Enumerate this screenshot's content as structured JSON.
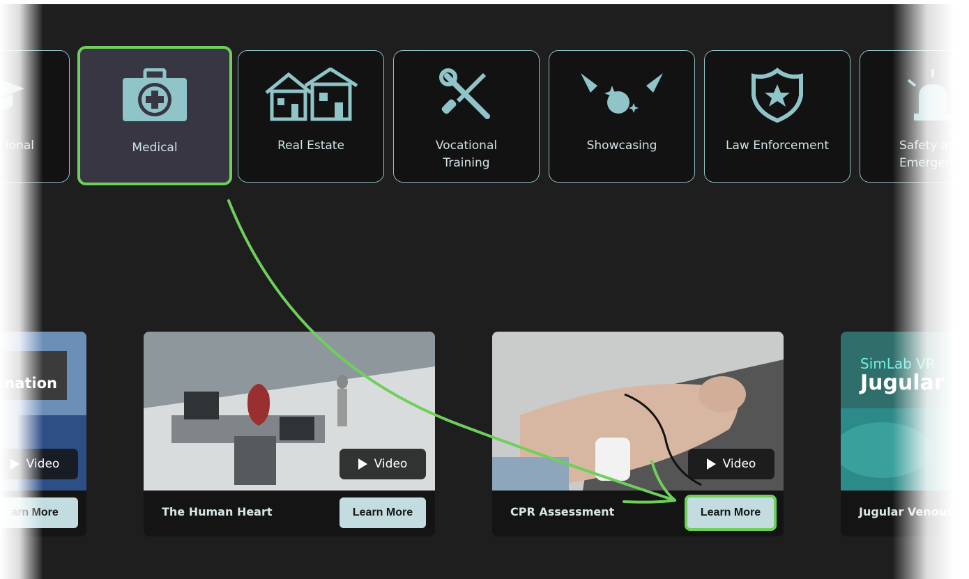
{
  "categories": [
    {
      "label": "ional",
      "icon": "graduation-cap-icon"
    },
    {
      "label": "Medical",
      "icon": "medical-kit-icon",
      "selected": true
    },
    {
      "label": "Real Estate",
      "icon": "houses-icon"
    },
    {
      "label": "Vocational\nTraining",
      "icon": "wrench-screwdriver-icon"
    },
    {
      "label": "Showcasing",
      "icon": "spotlight-icon"
    },
    {
      "label": "Law Enforcement",
      "icon": "police-badge-icon"
    },
    {
      "label": "Safety an\nEmergenc",
      "icon": "alarm-light-icon"
    }
  ],
  "courses": [
    {
      "title": "",
      "thumb_text": "nination",
      "video_label": "Video",
      "learn_label": "arn More"
    },
    {
      "title": "The Human Heart",
      "video_label": "Video",
      "learn_label": "Learn More"
    },
    {
      "title": "CPR Assessment",
      "video_label": "Video",
      "learn_label": "Learn More"
    },
    {
      "title": "Jugular Venous",
      "thumb_text_1": "SimLab VR",
      "thumb_text_2": "Jugular Vei"
    }
  ],
  "colors": {
    "accent_green": "#6ed05a",
    "icon_teal": "#8fc4c8",
    "button_bg": "#c2dcdf",
    "selected_bg": "#383643"
  }
}
